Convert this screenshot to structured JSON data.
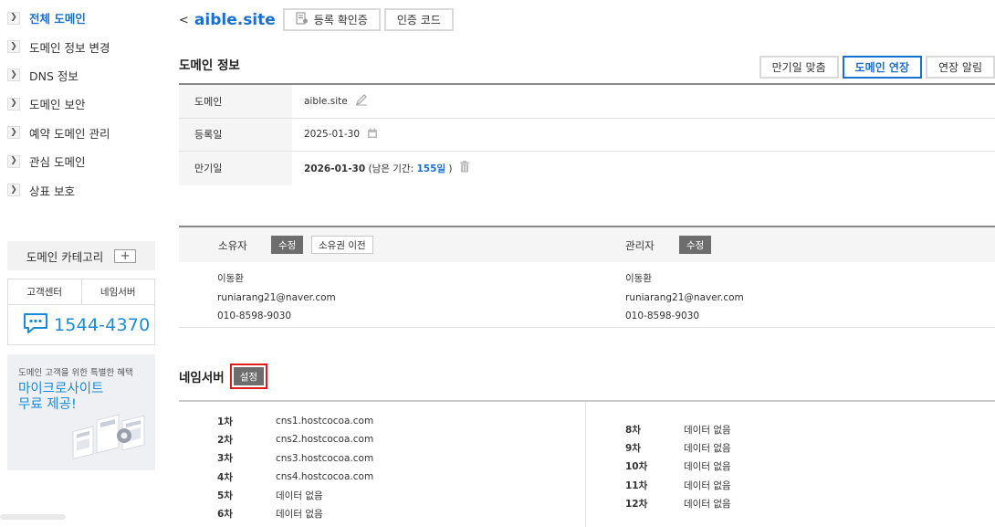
{
  "sidebar": {
    "nav": [
      {
        "label": "전체 도메인",
        "active": true
      },
      {
        "label": "도메인 정보 변경",
        "active": false
      },
      {
        "label": "DNS 정보",
        "active": false
      },
      {
        "label": "도메인 보안",
        "active": false
      },
      {
        "label": "예약 도메인 관리",
        "active": false
      },
      {
        "label": "관심 도메인",
        "active": false
      },
      {
        "label": "상표 보호",
        "active": false
      }
    ],
    "category_label": "도메인 카테고리",
    "category_add": "+",
    "support_tabs": [
      "고객센터",
      "네임서버"
    ],
    "phone": "1544-4370",
    "promo_small": "도메인 고객을 위한 특별한 혜택",
    "promo_line1": "마이크로사이트",
    "promo_line2": "무료 제공!"
  },
  "header": {
    "back": "<",
    "domain": "aible.site",
    "btn_registration": "등록 확인증",
    "btn_auth_code": "인증 코드"
  },
  "domain_info": {
    "title": "도메인 정보",
    "actions": [
      "만기일 맞춤",
      "도메인 연장",
      "연장 알림"
    ],
    "rows": {
      "domain_key": "도메인",
      "domain_val": "aible.site",
      "reg_key": "등록일",
      "reg_val": "2025-01-30",
      "exp_key": "만기일",
      "exp_date": "2026-01-30",
      "exp_prefix": "(남은 기간: ",
      "exp_days": "155일",
      "exp_suffix": " )"
    }
  },
  "contacts": {
    "owner_label": "소유자",
    "owner_edit": "수정",
    "owner_transfer": "소유권 이전",
    "owner": {
      "name": "이동환",
      "email": "runiarang21@naver.com",
      "phone": "010-8598-9030"
    },
    "admin_label": "관리자",
    "admin_edit": "수정",
    "admin": {
      "name": "이동환",
      "email": "runiarang21@naver.com",
      "phone": "010-8598-9030"
    }
  },
  "nameserver": {
    "title": "네임서버",
    "set_btn": "설정",
    "left": [
      {
        "idx": "1차",
        "value": "cns1.hostcocoa.com"
      },
      {
        "idx": "2차",
        "value": "cns2.hostcocoa.com"
      },
      {
        "idx": "3차",
        "value": "cns3.hostcocoa.com"
      },
      {
        "idx": "4차",
        "value": "cns4.hostcocoa.com"
      },
      {
        "idx": "5차",
        "value": "데이터 없음"
      },
      {
        "idx": "6차",
        "value": "데이터 없음"
      }
    ],
    "right": [
      {
        "idx": "8차",
        "value": "데이터 없음"
      },
      {
        "idx": "9차",
        "value": "데이터 없음"
      },
      {
        "idx": "10차",
        "value": "데이터 없음"
      },
      {
        "idx": "11차",
        "value": "데이터 없음"
      },
      {
        "idx": "12차",
        "value": "데이터 없음"
      }
    ]
  }
}
